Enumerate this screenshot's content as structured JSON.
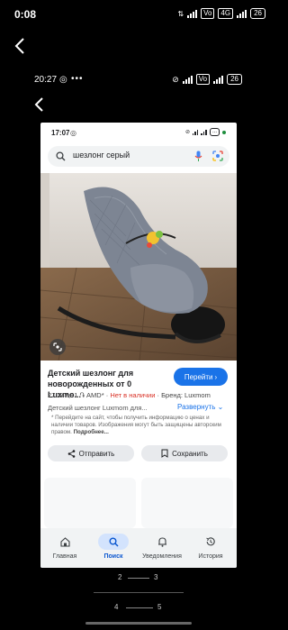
{
  "outer_status": {
    "time": "0:08",
    "network_tags": [
      "4G",
      "4G",
      "Vo"
    ],
    "battery": "26"
  },
  "mid_status": {
    "time": "20:27",
    "dots": "•••",
    "battery": "26"
  },
  "inner_status": {
    "time": "17:07",
    "battery": "..."
  },
  "search": {
    "query": "шезлонг серый"
  },
  "product": {
    "title": "Детский шезлонг для новорожденных от 0 Luxmo...",
    "goto_label": "Перейти",
    "price": "27 247,81 ֏ AMD*",
    "stock": "Нет в наличии",
    "brand": "Бренд: Luxmom",
    "description": "Детский шезлонг Luxmom для...",
    "expand_label": "Развернуть",
    "disclaimer": "* Перейдите на сайт, чтобы получить информацию о ценах и наличии товаров. Изображения могут быть защищены авторским правом.",
    "disclaimer_link": "Подробнее..."
  },
  "actions": {
    "share_label": "Отправить",
    "save_label": "Сохранить"
  },
  "nav": {
    "items": [
      {
        "label": "Главная",
        "icon": "home-icon"
      },
      {
        "label": "Поиск",
        "icon": "search-icon",
        "active": true
      },
      {
        "label": "Уведомления",
        "icon": "bell-icon"
      },
      {
        "label": "История",
        "icon": "history-icon"
      }
    ]
  },
  "pager": {
    "row1": [
      "2",
      "3"
    ],
    "row2": [
      "4",
      "5"
    ]
  },
  "colors": {
    "accent": "#1a73e8",
    "stock_red": "#d93025",
    "nav_active": "#d3e3fd"
  }
}
